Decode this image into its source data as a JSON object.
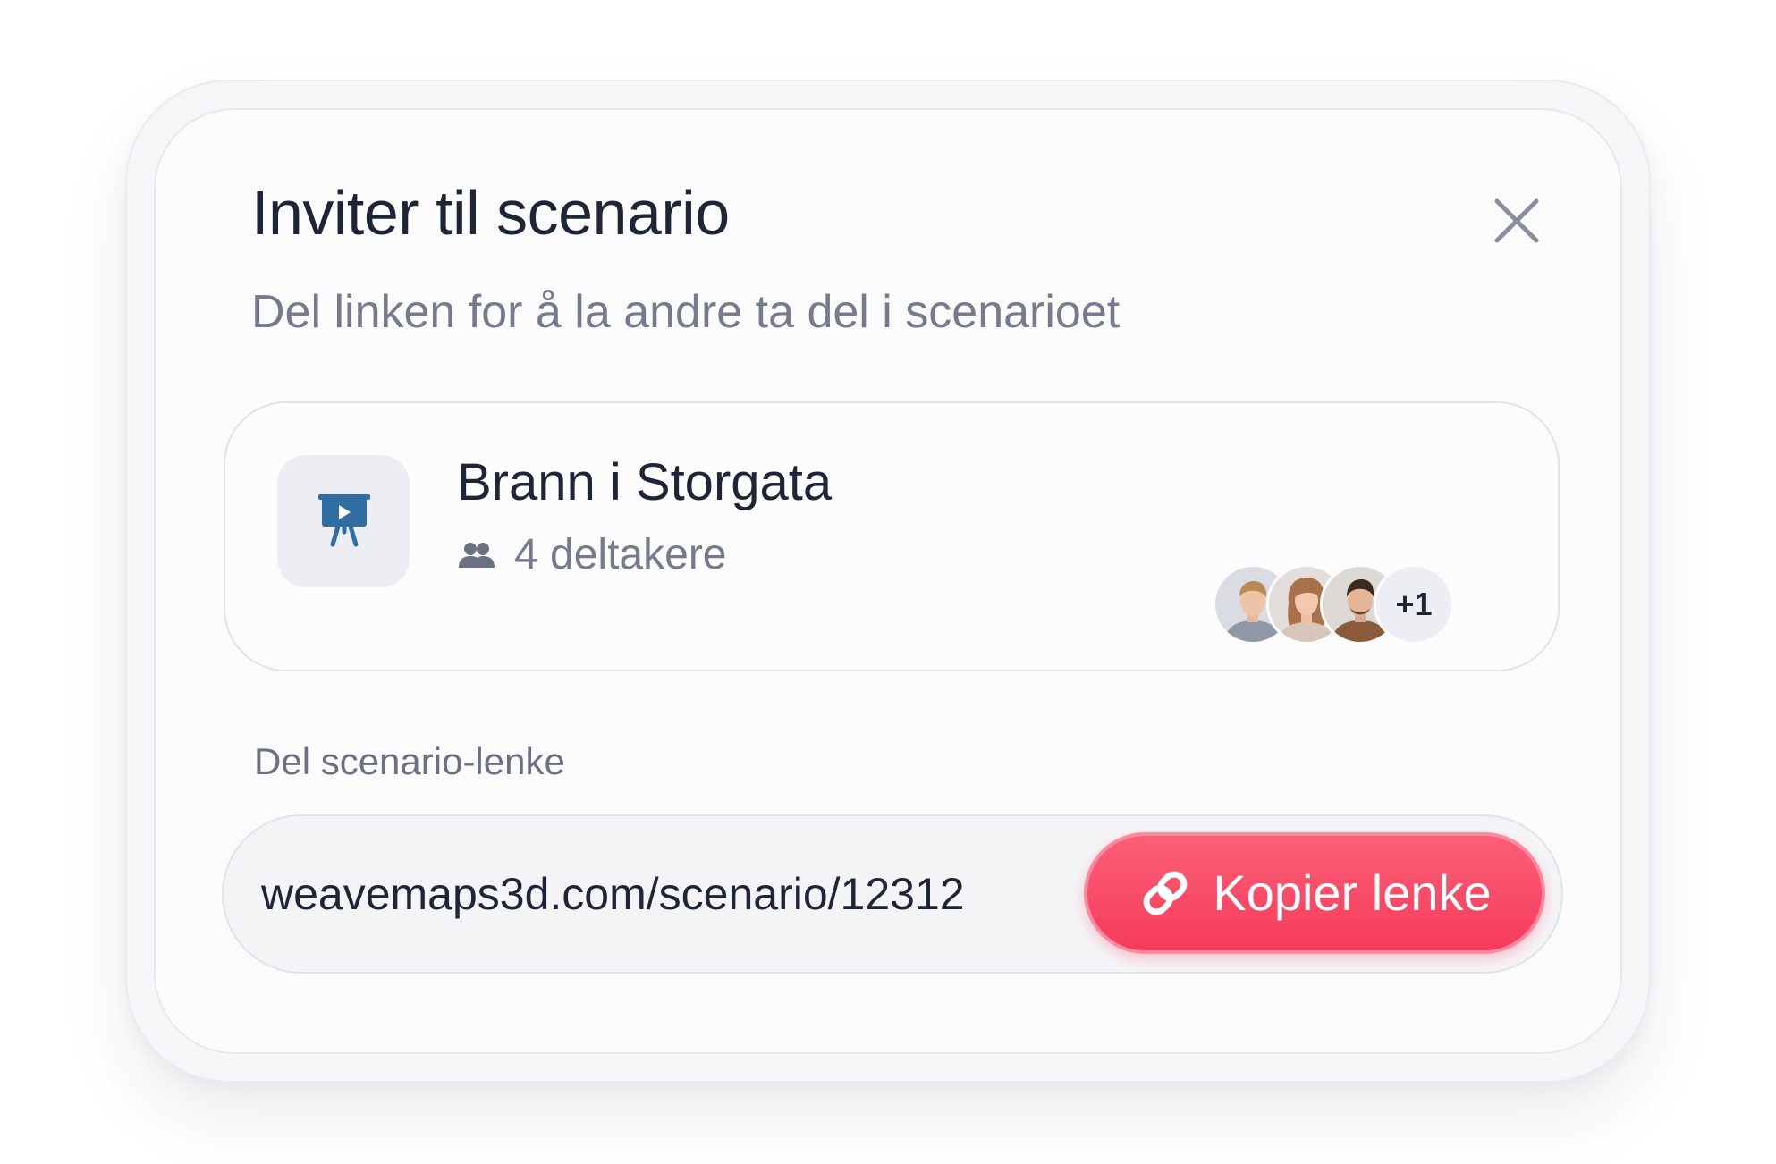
{
  "dialog": {
    "title": "Inviter til scenario",
    "subtitle": "Del linken for å la andre ta del i scenarioet",
    "close_icon": "close-icon"
  },
  "scenario": {
    "icon": "presentation-board-icon",
    "name": "Brann i Storgata",
    "participants_icon": "users-icon",
    "participants_text": "4 deltakere",
    "avatars": [
      {
        "name": "avatar-man-blond"
      },
      {
        "name": "avatar-woman"
      },
      {
        "name": "avatar-man-dark"
      }
    ],
    "more_count": "+1"
  },
  "share": {
    "label": "Del scenario-lenke",
    "url": "weavemaps3d.com/scenario/12312",
    "copy_button_label": "Kopier lenke",
    "copy_icon": "link-icon"
  },
  "colors": {
    "accent": "#f63b5c",
    "text_primary": "#1e2537",
    "text_secondary": "#757a8e",
    "icon_blue": "#2f6da3"
  }
}
